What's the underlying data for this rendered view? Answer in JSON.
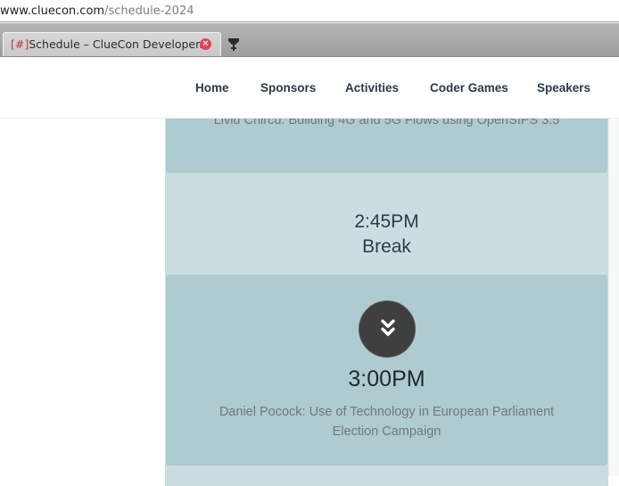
{
  "browser": {
    "url_host": "www.cluecon.com",
    "url_path": "/schedule-2024",
    "tab": {
      "marker": "[#]",
      "title": "Schedule – ClueCon Developer...",
      "close_icon": "close-icon"
    },
    "new_tab_icon": "new-tab-icon"
  },
  "nav": {
    "items": [
      {
        "label": "Home"
      },
      {
        "label": "Sponsors"
      },
      {
        "label": "Activities"
      },
      {
        "label": "Coder Games"
      },
      {
        "label": "Speakers"
      }
    ]
  },
  "schedule": {
    "sessions": [
      {
        "time": "",
        "title": "Liviu Chircu: Building 4G and 5G Flows using OpenSIPS 3.5"
      },
      {
        "time": "2:45PM",
        "title": "Break"
      },
      {
        "time": "3:00PM",
        "title_line1": "Daniel Pocock: Use of Technology in European Parliament",
        "title_line2": "Election Campaign",
        "icon": "chevron-double-down-icon"
      }
    ]
  },
  "colors": {
    "session_dark": "#aecbcf",
    "session_light": "#cadde0",
    "nav_text": "#2b3a44",
    "icon_circle": "#3f3f3f"
  }
}
